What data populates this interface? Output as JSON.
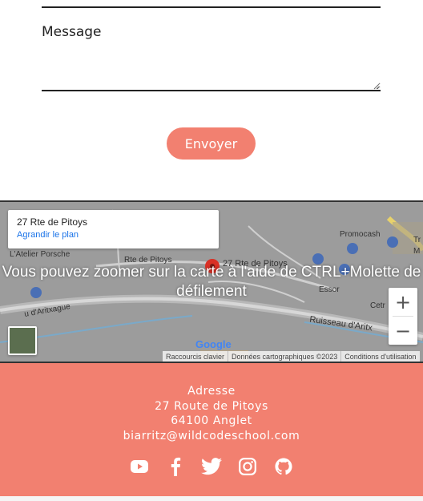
{
  "form": {
    "message_label": "Message",
    "message_value": "",
    "send_label": "Envoyer"
  },
  "map": {
    "card_title": "27 Rte de Pitoys",
    "card_link": "Agrandir le plan",
    "zoom_hint": "Vous pouvez zoomer sur la carte à l'aide de CTRL+Molette de défilement",
    "labels": {
      "atelier": "L'Atelier Porsche",
      "rte": "Rte de Pitoys",
      "pin_label": "27 Rte de Pitoys",
      "promocash": "Promocash",
      "essor": "Essor",
      "aritxague": "u d'Aritxague",
      "cetr": "Cetr",
      "ruisseau": "Ruisseau d'Aritx",
      "tr": "Tr",
      "m": "M"
    },
    "zoom_in": "+",
    "zoom_out": "−",
    "google": "Google",
    "attribution": {
      "shortcuts": "Raccourcis clavier",
      "data": "Données cartographiques ©2023",
      "terms": "Conditions d'utilisation"
    }
  },
  "footer": {
    "address_title": "Adresse",
    "street": "27 Route de Pitoys",
    "city": "64100 Anglet",
    "email": "biarritz@wildcodeschool.com",
    "socials": [
      "youtube-icon",
      "facebook-icon",
      "twitter-icon",
      "instagram-icon",
      "github-icon"
    ]
  },
  "colors": {
    "accent": "#f28070",
    "map_bg": "#9b9b9b",
    "link": "#1a73e8"
  }
}
